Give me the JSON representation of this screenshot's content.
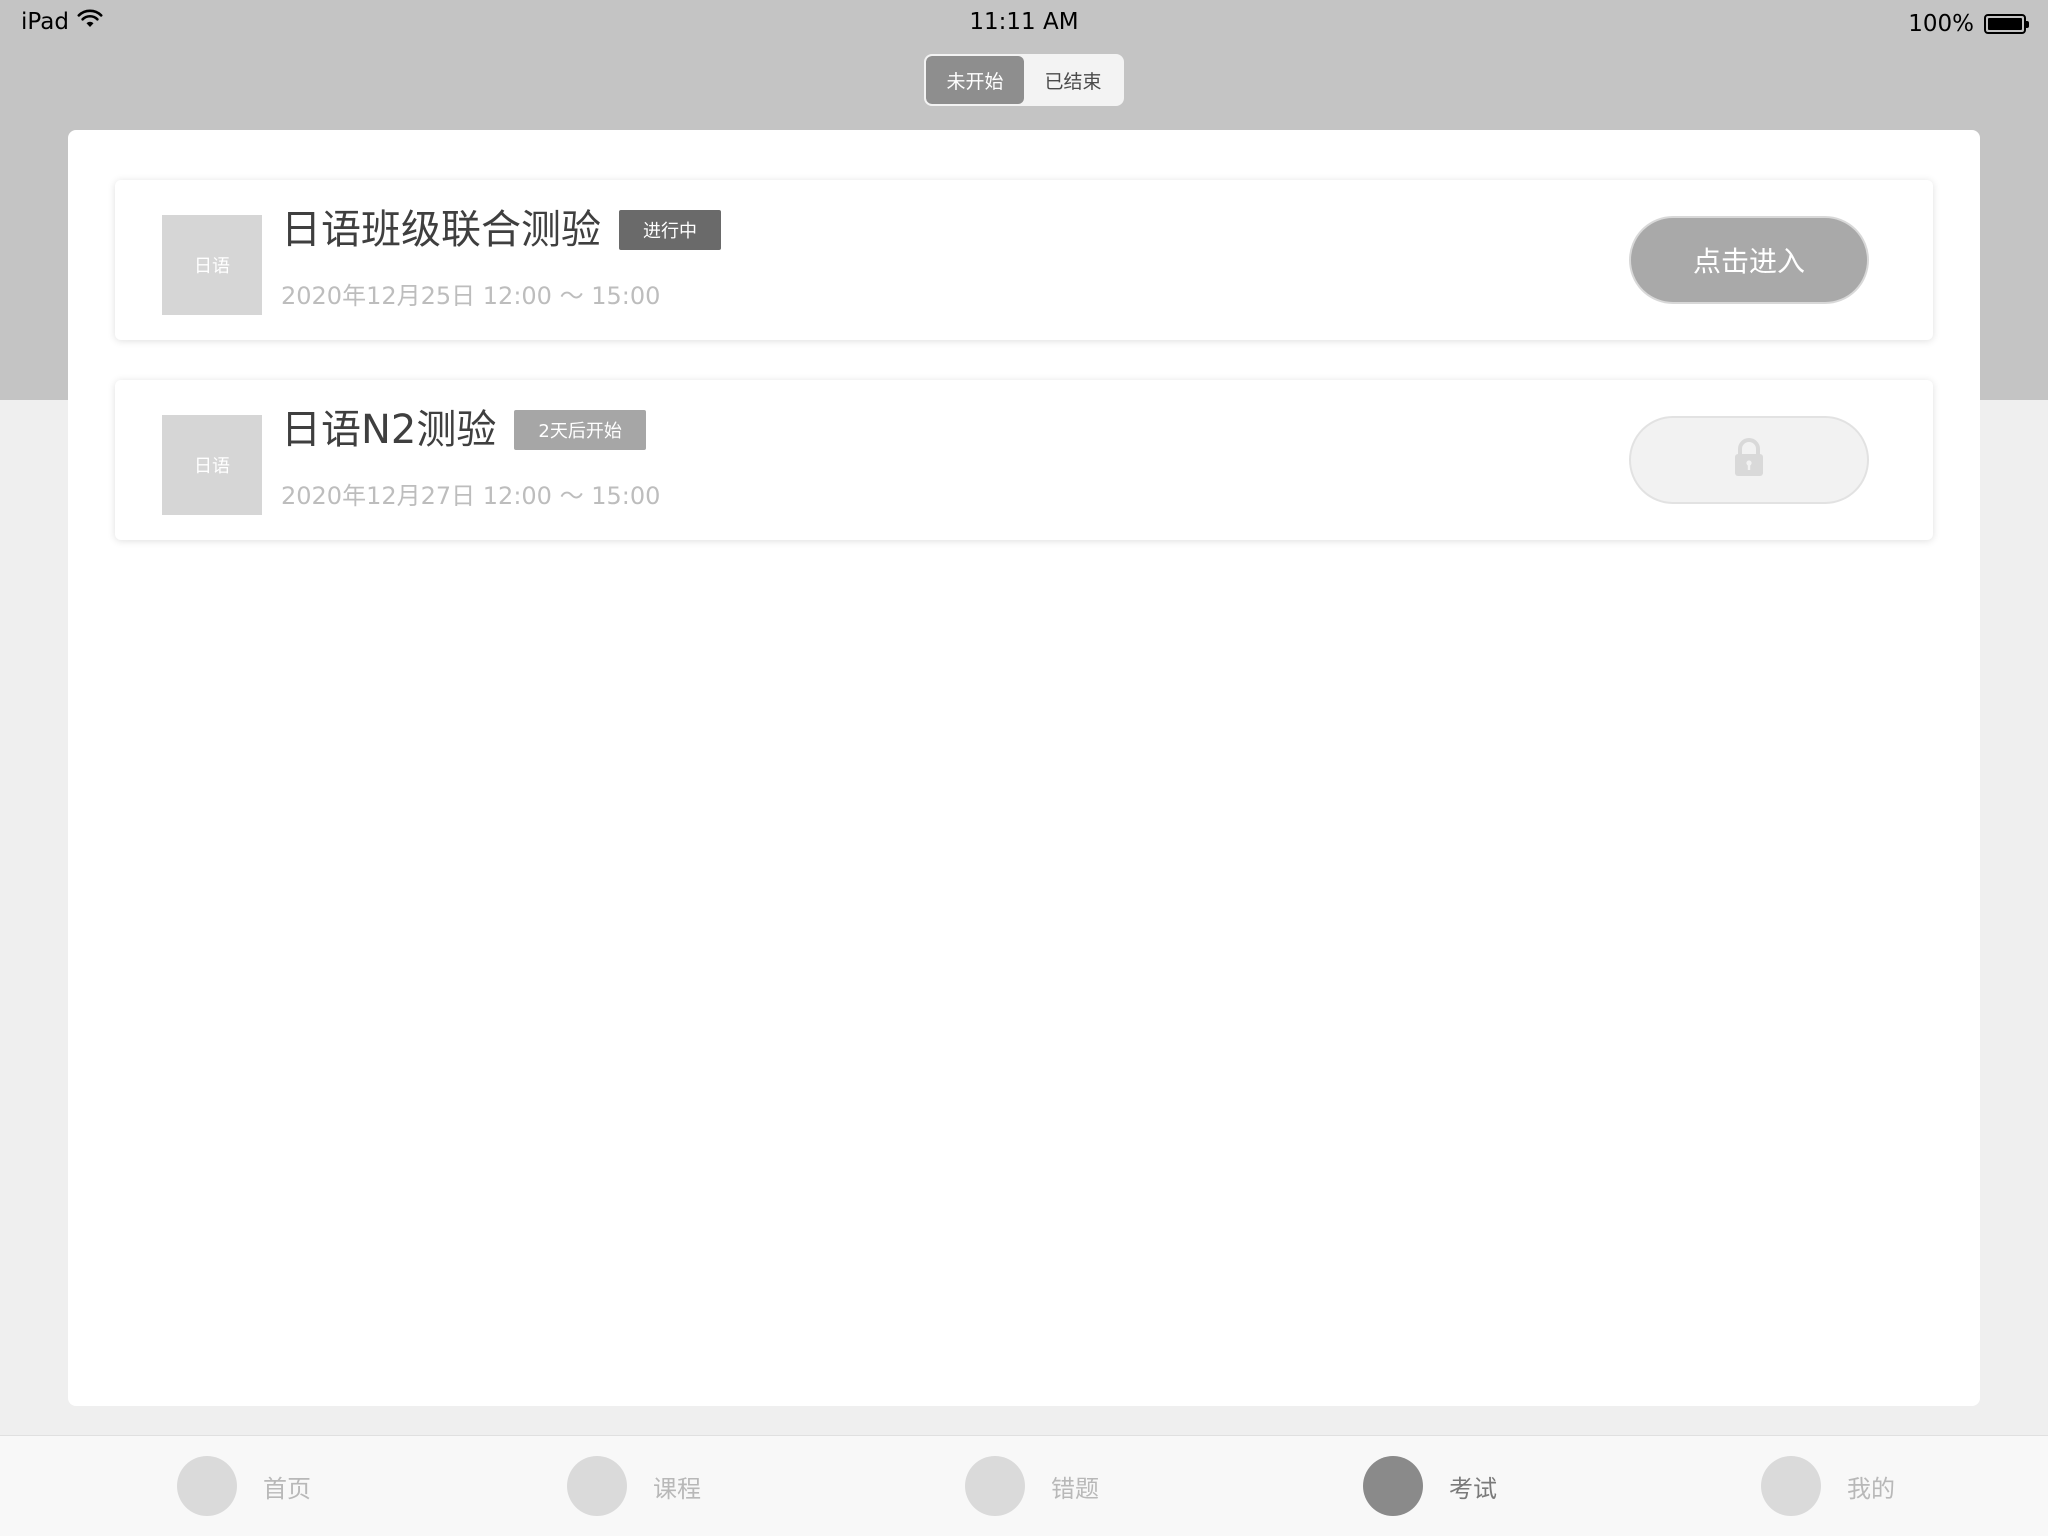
{
  "status_bar": {
    "device": "iPad",
    "time": "11:11 AM",
    "battery": "100%"
  },
  "segments": [
    {
      "label": "未开始",
      "active": true
    },
    {
      "label": "已结束",
      "active": false
    }
  ],
  "exams": [
    {
      "thumb_label": "日语",
      "title": "日语班级联合测验",
      "status": "进行中",
      "time": "2020年12月25日 12:00 ～ 15:00",
      "action_label": "点击进入",
      "locked": false
    },
    {
      "thumb_label": "日语",
      "title": "日语N2测验",
      "status": "2天后开始",
      "time": "2020年12月27日 12:00 ～ 15:00",
      "action_label": "",
      "locked": true
    }
  ],
  "tab_bar": {
    "items": [
      {
        "label": "首页",
        "active": false
      },
      {
        "label": "课程",
        "active": false
      },
      {
        "label": "错题",
        "active": false
      },
      {
        "label": "考试",
        "active": true
      },
      {
        "label": "我的",
        "active": false
      }
    ]
  },
  "colors": {
    "header_band": "#c4c4c4",
    "background": "#efefef",
    "active_segment": "#8e8e8e",
    "status_live": "#6a6a6a",
    "status_soon": "#a6a6a6",
    "primary_button": "#a9a9a9"
  },
  "icons": {
    "wifi": "wifi-icon",
    "battery": "battery-icon",
    "lock": "lock-icon"
  }
}
